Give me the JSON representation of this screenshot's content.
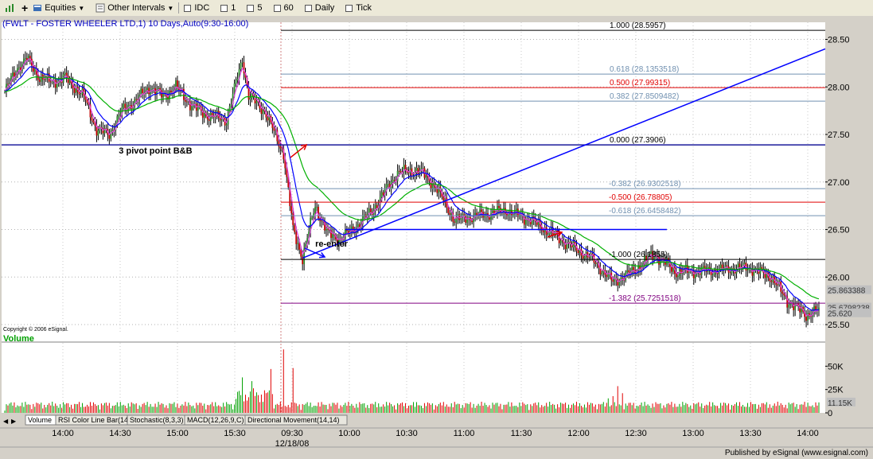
{
  "toolbar": {
    "items": [
      {
        "name": "chart-type-icon",
        "label": ""
      },
      {
        "name": "add-icon",
        "label": ""
      },
      {
        "name": "equities-dropdown",
        "label": "Equities"
      },
      {
        "name": "intervals-dropdown",
        "label": "Other Intervals"
      },
      {
        "name": "idc-button",
        "label": "IDC"
      },
      {
        "name": "interval-1",
        "label": "1"
      },
      {
        "name": "interval-5",
        "label": "5"
      },
      {
        "name": "interval-60",
        "label": "60"
      },
      {
        "name": "interval-daily",
        "label": "Daily"
      },
      {
        "name": "interval-tick",
        "label": "Tick"
      }
    ]
  },
  "chart_data": {
    "type": "candlestick",
    "title": "(FWLT - FOSTER WHEELER LTD,1) 10 Days,Auto(9:30-16:00)",
    "copyright": "Copyright © 2006 eSignal.",
    "date_label": "12/18/08",
    "publisher": "Published by eSignal (www.esignal.com)",
    "price_axis": {
      "ticks": [
        "28.50",
        "28.00",
        "27.50",
        "27.00",
        "26.50",
        "26.00",
        "25.50"
      ],
      "tick_values": [
        28.5,
        28.0,
        27.5,
        27.0,
        26.5,
        26.0,
        25.5
      ],
      "range": [
        25.4,
        28.68
      ]
    },
    "last_price_labels": [
      {
        "text": "25.863388",
        "value": 25.863,
        "color": "#c0c0c0",
        "fg": "#333"
      },
      {
        "text": "25.6798238",
        "value": 25.68,
        "color": "#c0c0c0",
        "fg": "#333"
      },
      {
        "text": "25.620",
        "value": 25.62,
        "color": "#c0c0c0",
        "fg": "#333"
      }
    ],
    "time_axis": [
      "14:00",
      "14:30",
      "15:00",
      "15:30",
      "09:30",
      "10:00",
      "10:30",
      "11:00",
      "11:30",
      "12:00",
      "12:30",
      "13:00",
      "13:30",
      "14:00"
    ],
    "volume_axis": {
      "title": "Volume",
      "ticks": [
        "50K",
        "25K",
        "0"
      ],
      "tick_values": [
        50000,
        25000,
        0
      ],
      "last": "11.15K",
      "max": 75000
    },
    "fib_upper": [
      {
        "ratio": "1.000",
        "label": "1.000 (28.5957)",
        "value": 28.5957,
        "color": "#000000"
      },
      {
        "ratio": "0.618",
        "label": "0.618 (28.1353518)",
        "value": 28.1354,
        "color": "#7090b0"
      },
      {
        "ratio": "0.500",
        "label": "0.500 (27.99315)",
        "value": 27.9932,
        "color": "#e00000"
      },
      {
        "ratio": "0.382",
        "label": "0.382 (27.8509482)",
        "value": 27.8509,
        "color": "#7090b0"
      },
      {
        "ratio": "0.000",
        "label": "0.000 (27.3906)",
        "value": 27.3906,
        "color": "#000000"
      }
    ],
    "fib_lower": [
      {
        "label": "-0.382 (26.9302518)",
        "value": 26.9303,
        "color": "#7090b0"
      },
      {
        "label": "-0.500 (26.78805)",
        "value": 26.7881,
        "color": "#e00000"
      },
      {
        "label": "-0.618 (26.6458482)",
        "value": 26.6458,
        "color": "#7090b0"
      },
      {
        "label": "-1.000 (26.1855)",
        "value": 26.1855,
        "color": "#000000"
      },
      {
        "label": "-1.382 (25.7251518)",
        "value": 25.7252,
        "color": "#800080"
      }
    ],
    "annotations": [
      {
        "text": "3 pivot point B&B",
        "price": 27.3,
        "slot": 72
      },
      {
        "text": "re-enter",
        "price": 26.32,
        "slot": 196
      }
    ],
    "tabs": [
      "Volume",
      "RSI Color Line Bar(14)",
      "Stochastic(8,3,3)",
      "MACD(12,26,9,C)",
      "Directional Movement(14,14)"
    ]
  }
}
